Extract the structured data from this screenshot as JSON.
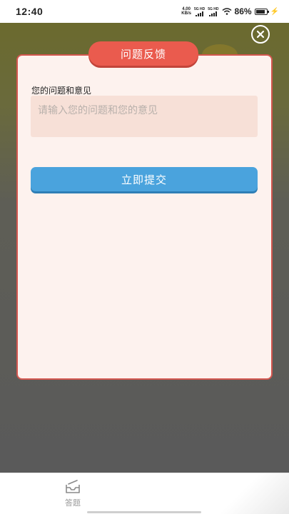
{
  "status_bar": {
    "time": "12:40",
    "speed_value": "4.00",
    "speed_unit": "KB/s",
    "net1": "5G HD",
    "net2": "5G HD",
    "battery": "86%"
  },
  "dialog": {
    "title": "问题反馈",
    "field_label": "您的问题和意见",
    "input_placeholder": "请输入您的问题和您的意见",
    "input_value": "",
    "submit_label": "立即提交"
  },
  "bottom_nav": {
    "items": [
      {
        "label": "答题",
        "icon": "answer-tray-icon"
      }
    ]
  },
  "colors": {
    "accent_red": "#ea5b4e",
    "accent_blue": "#4aa3dd",
    "dialog_bg": "#fdf2ee"
  }
}
